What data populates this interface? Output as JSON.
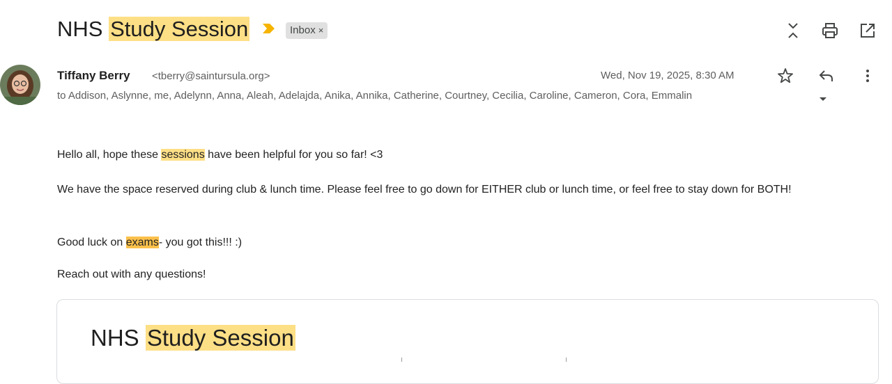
{
  "email": {
    "subject_plain": "NHS ",
    "subject_highlight": "Study Session",
    "label_chip": "Inbox",
    "label_chip_remove": "×",
    "sender": {
      "name": "Tiffany Berry",
      "email": "<tberry@saintursula.org>"
    },
    "recipients": "to Addison, Aslynne, me, Adelynn, Anna, Aleah, Adelajda, Anika, Annika, Catherine, Courtney, Cecilia, Caroline, Cameron, Cora, Emmalin",
    "date": "Wed, Nov 19, 2025, 8:30 AM",
    "body": {
      "p1_pre": "Hello all, hope these ",
      "p1_hl": "sessions",
      "p1_post": " have been helpful for you so far! <3",
      "p2": "We have the space reserved during club & lunch time. Please feel free to go down for EITHER club or lunch time, or feel free to stay down for BOTH!",
      "p3_pre": "Good luck on ",
      "p3_hl": "exams",
      "p3_post": "- you got this!!! :)",
      "p4": "Reach out with any questions!"
    },
    "card": {
      "title_plain": "NHS ",
      "title_highlight": "Study Session"
    }
  },
  "icons": {
    "importance": "importance-marker-icon",
    "expand_collapse": "expand-collapse-icon",
    "print": "print-icon",
    "open_new_window": "open-in-new-window-icon",
    "star": "star-icon",
    "reply": "reply-icon",
    "more": "more-vert-icon",
    "recipients_caret": "caret-down-icon"
  },
  "colors": {
    "highlight": "#fddf86",
    "highlight_strong": "#fbc04b",
    "importance": "#f6b400"
  }
}
